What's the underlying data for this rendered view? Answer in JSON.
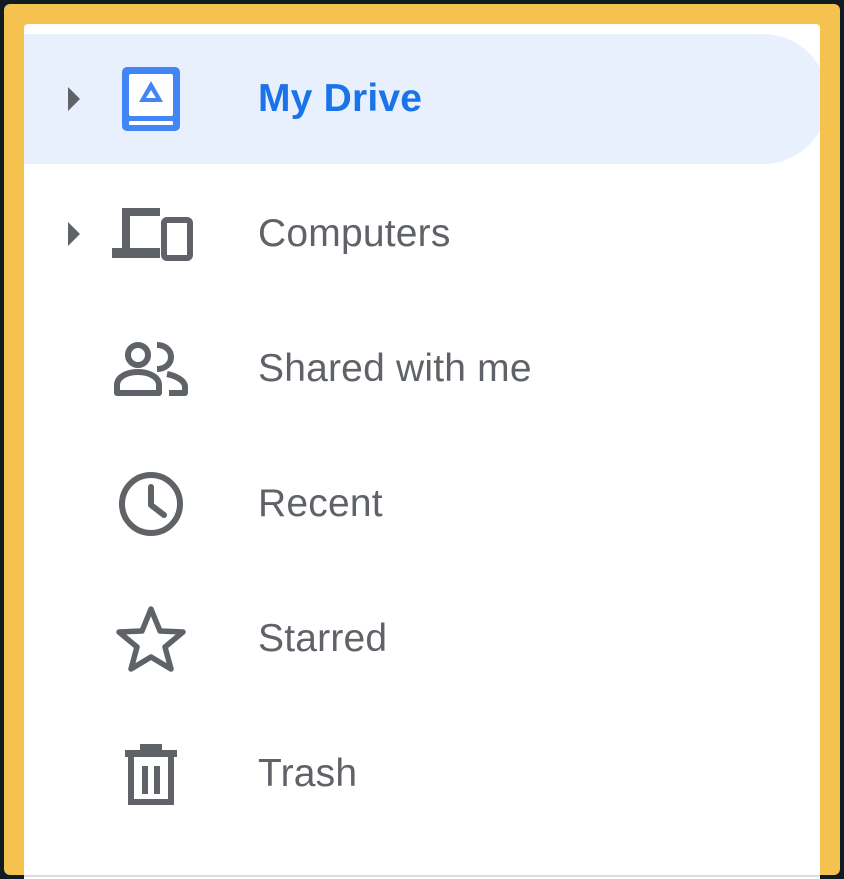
{
  "sidebar": {
    "items": [
      {
        "label": "My Drive",
        "icon": "my-drive-icon",
        "active": true,
        "expandable": true
      },
      {
        "label": "Computers",
        "icon": "computers-icon",
        "active": false,
        "expandable": true
      },
      {
        "label": "Shared with me",
        "icon": "shared-with-me-icon",
        "active": false,
        "expandable": false
      },
      {
        "label": "Recent",
        "icon": "clock-icon",
        "active": false,
        "expandable": false
      },
      {
        "label": "Starred",
        "icon": "star-icon",
        "active": false,
        "expandable": false
      },
      {
        "label": "Trash",
        "icon": "trash-icon",
        "active": false,
        "expandable": false
      }
    ]
  },
  "colors": {
    "active_text": "#1a73e8",
    "active_background": "#e8f0fe",
    "text": "#5f6368",
    "highlight_border": "#f6c24f"
  }
}
